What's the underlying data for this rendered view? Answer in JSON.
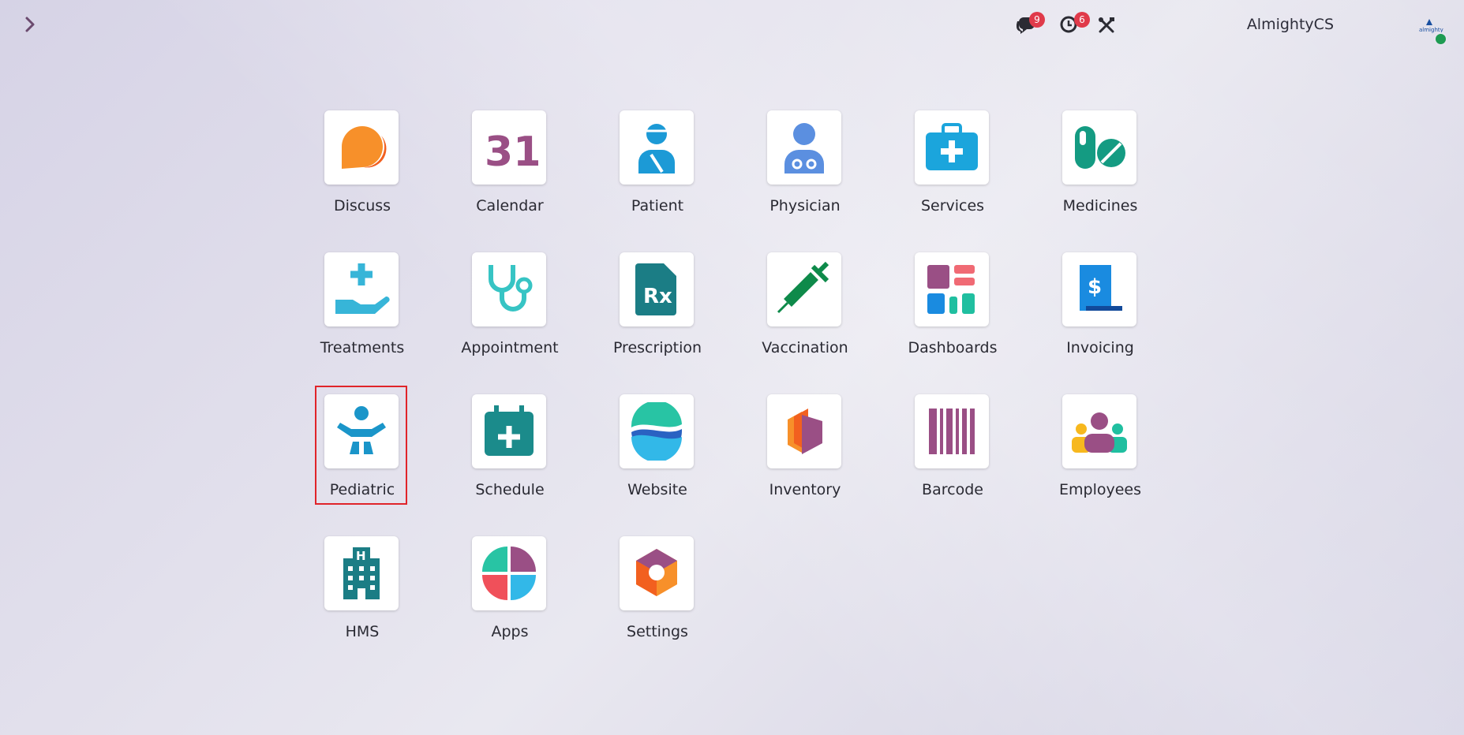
{
  "header": {
    "company_name": "AlmightyCS",
    "messages_count": "9",
    "activities_count": "6",
    "avatar_text": "almighty",
    "icons": {
      "menu": "chevron-right-icon",
      "messages": "chat-bubbles-icon",
      "activities": "clock-icon",
      "debug": "tools-icon"
    }
  },
  "apps": [
    {
      "label": "Discuss"
    },
    {
      "label": "Calendar",
      "icon_text": "31"
    },
    {
      "label": "Patient"
    },
    {
      "label": "Physician"
    },
    {
      "label": "Services"
    },
    {
      "label": "Medicines"
    },
    {
      "label": "Treatments"
    },
    {
      "label": "Appointment"
    },
    {
      "label": "Prescription",
      "icon_text": "Rx"
    },
    {
      "label": "Vaccination"
    },
    {
      "label": "Dashboards"
    },
    {
      "label": "Invoicing",
      "icon_text": "$"
    },
    {
      "label": "Pediatric"
    },
    {
      "label": "Schedule"
    },
    {
      "label": "Website"
    },
    {
      "label": "Inventory"
    },
    {
      "label": "Barcode"
    },
    {
      "label": "Employees"
    },
    {
      "label": "HMS",
      "icon_text": "H"
    },
    {
      "label": "Apps"
    },
    {
      "label": "Settings"
    }
  ],
  "colors": {
    "badge": "#e03a4a",
    "selection_outline": "#e0242a",
    "presence": "#1e9b52"
  },
  "selected_app": "Pediatric"
}
